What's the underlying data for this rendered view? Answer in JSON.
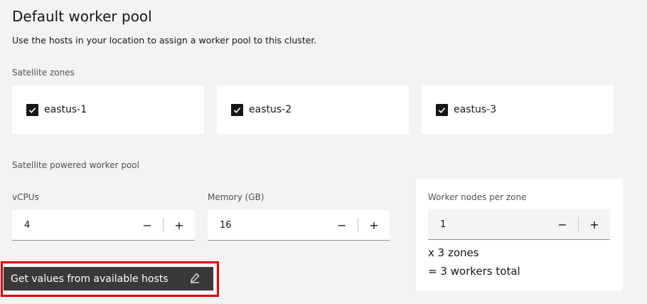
{
  "header": {
    "title": "Default worker pool",
    "description": "Use the hosts in your location to assign a worker pool to this cluster."
  },
  "zones": {
    "label": "Satellite zones",
    "items": [
      {
        "label": "eastus-1",
        "checked": true
      },
      {
        "label": "eastus-2",
        "checked": true
      },
      {
        "label": "eastus-3",
        "checked": true
      }
    ]
  },
  "worker_pool": {
    "label": "Satellite powered worker pool",
    "vcpus": {
      "label": "vCPUs",
      "value": "4",
      "decrement": "−",
      "increment": "+"
    },
    "memory": {
      "label": "Memory (GB)",
      "value": "16",
      "decrement": "−",
      "increment": "+"
    },
    "nodes": {
      "label": "Worker nodes per zone",
      "value": "1",
      "decrement": "−",
      "increment": "+"
    },
    "zones_multiplier": "x 3 zones",
    "workers_total": "= 3 workers total",
    "get_values_button": "Get values from available hosts"
  },
  "colors": {
    "button_bg": "#393939",
    "highlight": "#e00000",
    "checkbox": "#161616"
  },
  "icons": {
    "checkbox": "checkmark-icon",
    "edit": "edit-pencil-icon"
  }
}
